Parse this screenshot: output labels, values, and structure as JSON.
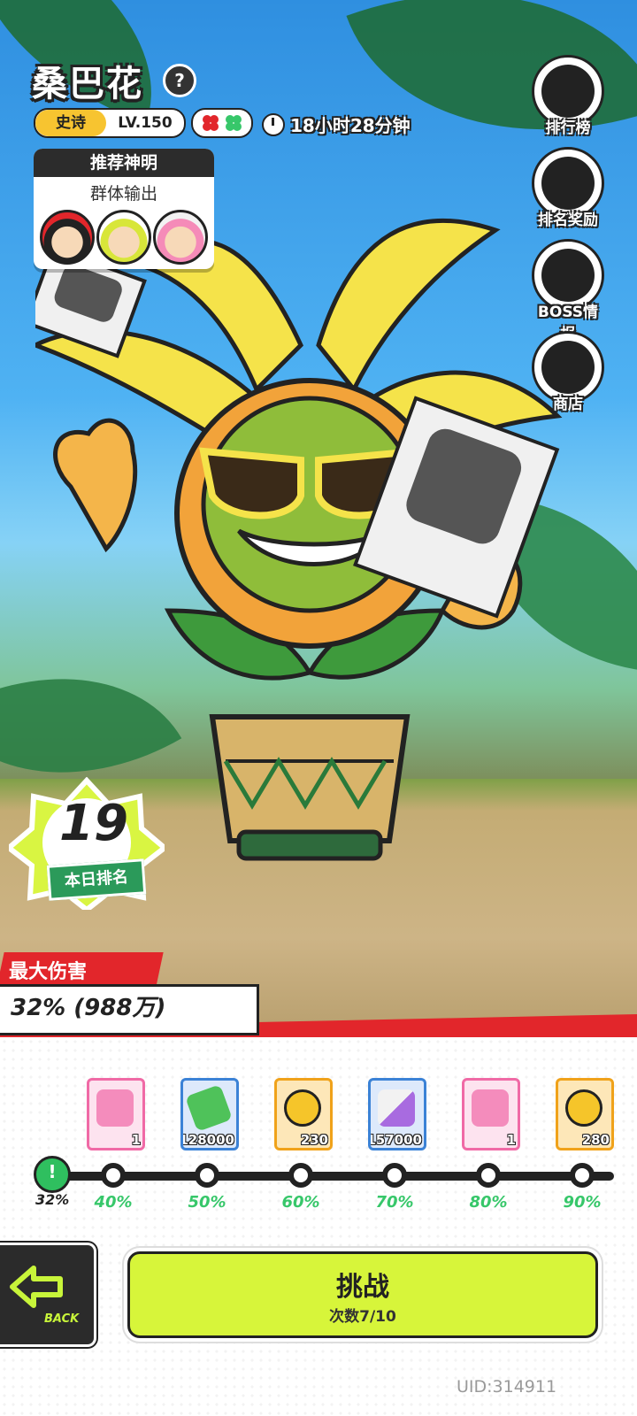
{
  "boss": {
    "name": "桑巴花",
    "rarity": "史诗",
    "level": "LV.150",
    "timer": "18小时28分钟"
  },
  "recommend": {
    "title": "推荐神明",
    "subtitle": "群体输出",
    "avatars": [
      "avatar-red",
      "avatar-green",
      "avatar-pink"
    ]
  },
  "side_buttons": [
    {
      "label": "排行榜",
      "icon": "trophy-icon"
    },
    {
      "label": "排名奖励",
      "icon": "gift-box-icon"
    },
    {
      "label": "BOSS情报",
      "icon": "skull-icon"
    },
    {
      "label": "商店",
      "icon": "cart-icon"
    }
  ],
  "daily_rank": {
    "value": "19",
    "label": "本日排名"
  },
  "max_damage": {
    "title": "最大伤害",
    "value": "32% (988万)"
  },
  "rewards": [
    {
      "qty": "1",
      "icon": "pink-gift-box-icon",
      "color": "#f06aa6"
    },
    {
      "qty": "128000",
      "icon": "cash-icon",
      "color": "#3b82d6"
    },
    {
      "qty": "230",
      "icon": "gold-coin-icon",
      "color": "#f0a21a"
    },
    {
      "qty": "157000",
      "icon": "paint-tube-icon",
      "color": "#3b82d6"
    },
    {
      "qty": "1",
      "icon": "pink-gift-box-icon",
      "color": "#f06aa6"
    },
    {
      "qty": "280",
      "icon": "gold-coin-icon",
      "color": "#f0a21a"
    }
  ],
  "progress": {
    "current": "32%",
    "current_fraction": 0.32,
    "milestones": [
      "40%",
      "50%",
      "60%",
      "70%",
      "80%",
      "90%"
    ]
  },
  "back": {
    "label": "BACK"
  },
  "challenge": {
    "title": "挑战",
    "count": "次数7/10"
  },
  "uid": "UID:314911",
  "colors": {
    "accent": "#d7f53a",
    "red": "#e2262b",
    "green": "#37c76a"
  }
}
